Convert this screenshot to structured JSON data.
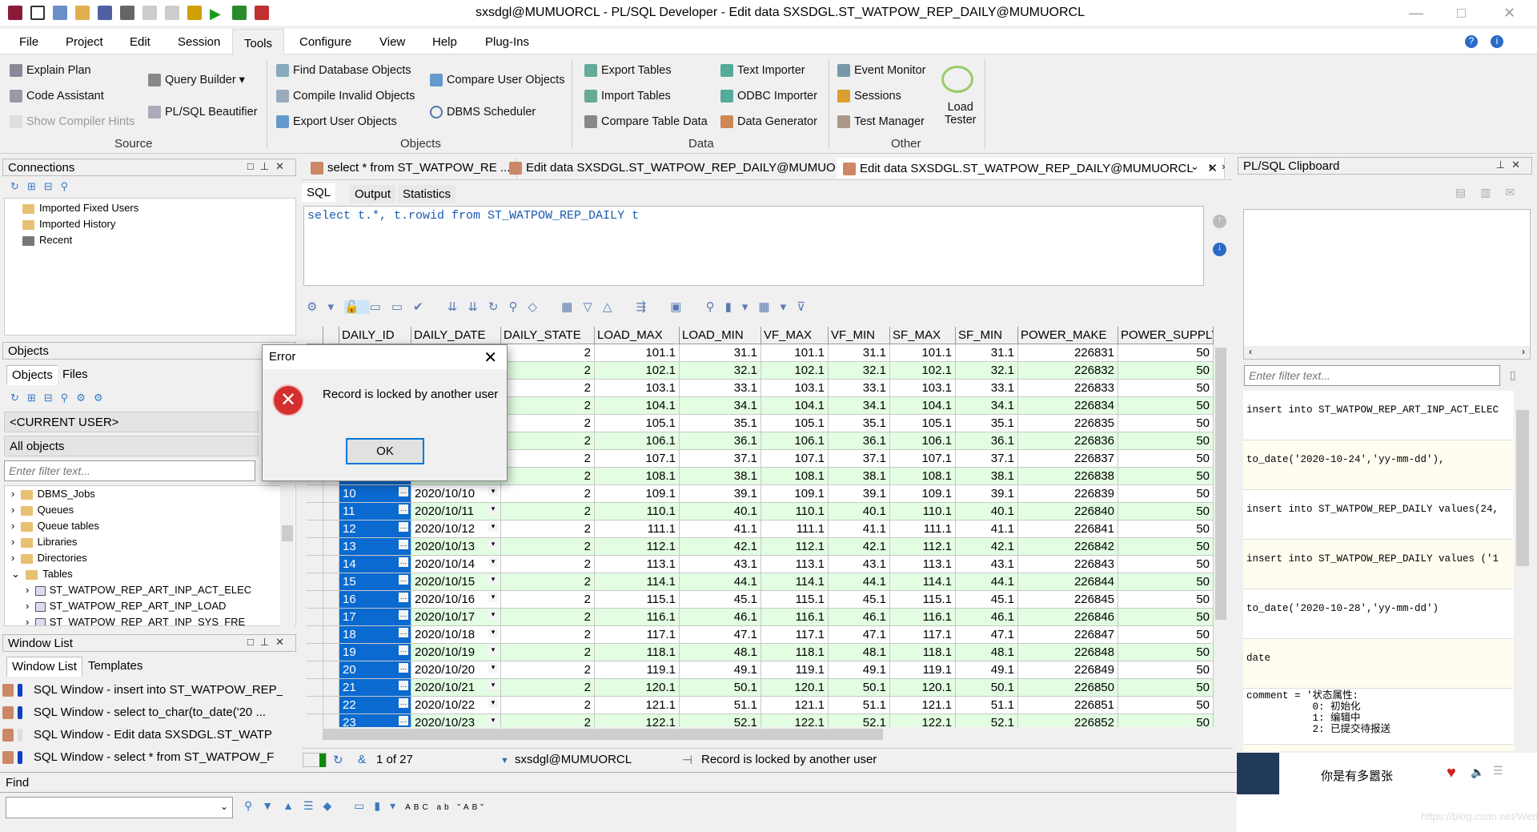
{
  "window": {
    "title": "sxsdgl@MUMUORCL - PL/SQL Developer - Edit data SXSDGL.ST_WATPOW_REP_DAILY@MUMUORCL"
  },
  "menu": [
    "File",
    "Project",
    "Edit",
    "Session",
    "Tools",
    "Configure",
    "View",
    "Help",
    "Plug-Ins"
  ],
  "ribbon": {
    "source": {
      "label": "Source",
      "explain": "Explain Plan",
      "code": "Code Assistant",
      "hints": "Show Compiler Hints",
      "qb": "Query Builder",
      "beaut": "PL/SQL Beautifier"
    },
    "objects": {
      "label": "Objects",
      "find": "Find Database Objects",
      "compile": "Compile Invalid Objects",
      "export": "Export User Objects",
      "compare": "Compare User Objects",
      "dbms": "DBMS Scheduler"
    },
    "data": {
      "label": "Data",
      "export": "Export Tables",
      "import": "Import Tables",
      "compare": "Compare Table Data",
      "text": "Text Importer",
      "odbc": "ODBC Importer",
      "gen": "Data Generator"
    },
    "other": {
      "label": "Other",
      "event": "Event Monitor",
      "sessions": "Sessions",
      "test": "Test Manager",
      "load1": "Load",
      "load2": "Tester"
    }
  },
  "connections": {
    "title": "Connections",
    "items": [
      "Imported Fixed Users",
      "Imported History",
      "Recent"
    ]
  },
  "objects": {
    "title": "Objects",
    "tabs": [
      "Objects",
      "Files"
    ],
    "user": "<CURRENT USER>",
    "filter_sel": "All objects",
    "filter_placeholder": "Enter filter text...",
    "tree": [
      "DBMS_Jobs",
      "Queues",
      "Queue tables",
      "Libraries",
      "Directories",
      "Tables"
    ],
    "tables": [
      "ST_WATPOW_REP_ART_INP_ACT_ELEC",
      "ST_WATPOW_REP_ART_INP_LOAD",
      "ST_WATPOW_REP_ART_INP_SYS_FRE"
    ]
  },
  "windowlist": {
    "title": "Window List",
    "tabs": [
      "Window List",
      "Templates"
    ],
    "items": [
      "SQL Window - insert into ST_WATPOW_REP_",
      "SQL Window - select to_char(to_date('20 ...",
      "SQL Window - Edit data SXSDGL.ST_WATP",
      "SQL Window - select * from ST_WATPOW_F"
    ]
  },
  "find": {
    "label": "Find"
  },
  "doctabs": [
    "select * from ST_WATPOW_RE ...",
    "Edit data SXSDGL.ST_WATPOW_REP_DAILY@MUMUORCL",
    "Edit data SXSDGL.ST_WATPOW_REP_DAILY@MUMUORCL"
  ],
  "subtabs": [
    "SQL",
    "Output",
    "Statistics"
  ],
  "sql": "select t.*, t.rowid from ST_WATPOW_REP_DAILY t",
  "grid": {
    "columns": [
      "DAILY_ID",
      "DAILY_DATE",
      "DAILY_STATE",
      "LOAD_MAX",
      "LOAD_MIN",
      "VF_MAX",
      "VF_MIN",
      "SF_MAX",
      "SF_MIN",
      "POWER_MAKE",
      "POWER_SUPPLY"
    ],
    "rows": [
      [
        "",
        "",
        "2",
        "101.1",
        "31.1",
        "101.1",
        "31.1",
        "101.1",
        "31.1",
        "226831",
        "50"
      ],
      [
        "",
        "",
        "2",
        "102.1",
        "32.1",
        "102.1",
        "32.1",
        "102.1",
        "32.1",
        "226832",
        "50"
      ],
      [
        "",
        "",
        "2",
        "103.1",
        "33.1",
        "103.1",
        "33.1",
        "103.1",
        "33.1",
        "226833",
        "50"
      ],
      [
        "",
        "",
        "2",
        "104.1",
        "34.1",
        "104.1",
        "34.1",
        "104.1",
        "34.1",
        "226834",
        "50"
      ],
      [
        "",
        "",
        "2",
        "105.1",
        "35.1",
        "105.1",
        "35.1",
        "105.1",
        "35.1",
        "226835",
        "50"
      ],
      [
        "",
        "",
        "2",
        "106.1",
        "36.1",
        "106.1",
        "36.1",
        "106.1",
        "36.1",
        "226836",
        "50"
      ],
      [
        "",
        "",
        "2",
        "107.1",
        "37.1",
        "107.1",
        "37.1",
        "107.1",
        "37.1",
        "226837",
        "50"
      ],
      [
        "",
        "",
        "2",
        "108.1",
        "38.1",
        "108.1",
        "38.1",
        "108.1",
        "38.1",
        "226838",
        "50"
      ],
      [
        "10",
        "2020/10/10",
        "2",
        "109.1",
        "39.1",
        "109.1",
        "39.1",
        "109.1",
        "39.1",
        "226839",
        "50"
      ],
      [
        "11",
        "2020/10/11",
        "2",
        "110.1",
        "40.1",
        "110.1",
        "40.1",
        "110.1",
        "40.1",
        "226840",
        "50"
      ],
      [
        "12",
        "2020/10/12",
        "2",
        "111.1",
        "41.1",
        "111.1",
        "41.1",
        "111.1",
        "41.1",
        "226841",
        "50"
      ],
      [
        "13",
        "2020/10/13",
        "2",
        "112.1",
        "42.1",
        "112.1",
        "42.1",
        "112.1",
        "42.1",
        "226842",
        "50"
      ],
      [
        "14",
        "2020/10/14",
        "2",
        "113.1",
        "43.1",
        "113.1",
        "43.1",
        "113.1",
        "43.1",
        "226843",
        "50"
      ],
      [
        "15",
        "2020/10/15",
        "2",
        "114.1",
        "44.1",
        "114.1",
        "44.1",
        "114.1",
        "44.1",
        "226844",
        "50"
      ],
      [
        "16",
        "2020/10/16",
        "2",
        "115.1",
        "45.1",
        "115.1",
        "45.1",
        "115.1",
        "45.1",
        "226845",
        "50"
      ],
      [
        "17",
        "2020/10/17",
        "2",
        "116.1",
        "46.1",
        "116.1",
        "46.1",
        "116.1",
        "46.1",
        "226846",
        "50"
      ],
      [
        "18",
        "2020/10/18",
        "2",
        "117.1",
        "47.1",
        "117.1",
        "47.1",
        "117.1",
        "47.1",
        "226847",
        "50"
      ],
      [
        "19",
        "2020/10/19",
        "2",
        "118.1",
        "48.1",
        "118.1",
        "48.1",
        "118.1",
        "48.1",
        "226848",
        "50"
      ],
      [
        "20",
        "2020/10/20",
        "2",
        "119.1",
        "49.1",
        "119.1",
        "49.1",
        "119.1",
        "49.1",
        "226849",
        "50"
      ],
      [
        "21",
        "2020/10/21",
        "2",
        "120.1",
        "50.1",
        "120.1",
        "50.1",
        "120.1",
        "50.1",
        "226850",
        "50"
      ],
      [
        "22",
        "2020/10/22",
        "2",
        "121.1",
        "51.1",
        "121.1",
        "51.1",
        "121.1",
        "51.1",
        "226851",
        "50"
      ],
      [
        "23",
        "2020/10/23",
        "2",
        "122.1",
        "52.1",
        "122.1",
        "52.1",
        "122.1",
        "52.1",
        "226852",
        "50"
      ]
    ]
  },
  "status": {
    "record": "1 of 27",
    "connection": "sxsdgl@MUMUORCL",
    "message": "Record is locked by another user"
  },
  "dialog": {
    "title": "Error",
    "message": "Record is locked by another user",
    "ok": "OK"
  },
  "clipboard": {
    "title": "PL/SQL Clipboard",
    "filter_placeholder": "Enter filter text...",
    "items": [
      "insert into ST_WATPOW_REP_ART_INP_ACT_ELEC",
      "to_date('2020-10-24','yy-mm-dd'),",
      "insert into ST_WATPOW_REP_DAILY values(24,",
      "insert into ST_WATPOW_REP_DAILY values ('1",
      "to_date('2020-10-28','yy-mm-dd')",
      "date",
      "comment = '状态属性:\n           0: 初始化\n           1: 编辑中\n           2: 已提交待报送"
    ]
  },
  "music": {
    "song": "你是有多嚣张"
  },
  "watermark": "https://blog.csdn.net/Wendy_",
  "colors": {
    "selection": "#0a6ad0",
    "alt_row": "#e2fde2",
    "error": "#d32f2f"
  }
}
